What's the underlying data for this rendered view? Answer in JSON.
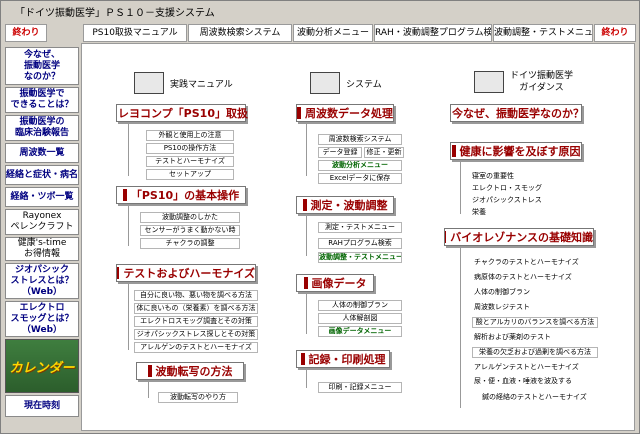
{
  "window": {
    "title": "「ドイツ振動医学」ＰＳ１０－支援システム"
  },
  "toolbar": {
    "left_close": "終わり",
    "right_close": "終わり",
    "tabs": [
      "PS10取扱マニュアル",
      "周波数検索システム",
      "波動分析メニュー",
      "RAH・波動調整プログラム検索",
      "波動調整・テストメニュー"
    ]
  },
  "sidebar": {
    "items": [
      "今なぜ、\n振動医学\nなのか？",
      "振動医学で\nできることは？",
      "振動医学の\n臨床治験報告",
      "周波数一覧",
      "経絡と症状・病名",
      "経絡・ツボ一覧",
      "Rayonex\nペレンクラフト",
      "健康's-time\nお得情報",
      "ジオパシック\nストレスとは？\n（Web）",
      "エレクトロ\nスモッグとは？\n（Web）"
    ],
    "calendar": "カレンダー",
    "now": "現在時刻"
  },
  "sections": {
    "manual": {
      "header": "実践マニュアル",
      "groups": [
        {
          "title": "レヨコンプ「PS10」取扱",
          "items": [
            "外観と使用上の注意",
            "PS10の操作方法",
            "テストとハーモナイズ",
            "セットアップ"
          ]
        },
        {
          "title": "「PS10」の基本操作",
          "items": [
            "波動調整のしかた",
            "センサーがうまく動かない時",
            "チャクラの調整"
          ]
        },
        {
          "title": "テストおよびハーモナイズ",
          "items": [
            "自分に良い物、悪い物を調べる方法",
            "体に良いもの（栄養素）を調べる方法",
            "エレクトロスモッグ調査とその対策",
            "ジオパシックストレス探しとその対策",
            "アレルゲンのテストとハーモナイズ"
          ]
        },
        {
          "title": "波動転写の方法",
          "items": [
            "波動転写のやり方"
          ]
        }
      ]
    },
    "system": {
      "header": "システム",
      "groups": [
        {
          "title": "周波数データ処理",
          "items": [
            "周波数検索システム",
            "データ登録",
            "修正・更新",
            "波動分析メニュー",
            "Excelデータに保存"
          ]
        },
        {
          "title": "測定・波動調整",
          "items": [
            "測定・テストメニュー",
            "RAHプログラム検索",
            "波動調整・テストメニュー"
          ]
        },
        {
          "title": "画像データ",
          "items": [
            "人体の制御ブラン",
            "人体解剖図",
            "画像データメニュー"
          ]
        },
        {
          "title": "記録・印刷処理",
          "items": [
            "印刷・記録メニュー"
          ]
        }
      ]
    },
    "guidance": {
      "header_line1": "ドイツ振動医学",
      "header_line2": "ガイダンス",
      "groups": [
        {
          "title": "今なぜ、振動医学なのか？",
          "items": []
        },
        {
          "title": "健康に影響を及ぼす原因",
          "items": [
            "寝室の重要性",
            "エレクトロ・スモッグ",
            "ジオパシックストレス",
            "栄養"
          ]
        },
        {
          "title": "バイオレゾナンスの基礎知識",
          "items": [
            "チャクラのテストとハーモナイズ",
            "病原体のテストとハーモナイズ",
            "人体の制御ブラン",
            "周波数レジテスト",
            "酸とアルカリのバランスを調べる方法",
            "解析および薬剤のテスト",
            "栄養の欠乏および過剰を調べる方法",
            "アレルゲンテストとハーモナイズ",
            "尿・便・血液・唾液を波及する",
            "鍼の経絡のテストとハーモナイズ"
          ]
        }
      ]
    }
  }
}
